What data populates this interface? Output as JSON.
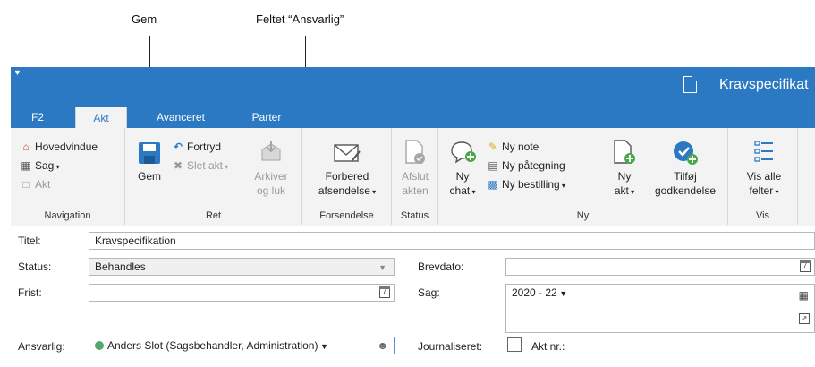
{
  "callouts": {
    "gem": "Gem",
    "ansvarlig": "Feltet “Ansvarlig”"
  },
  "window": {
    "title": "Kravspecifikat"
  },
  "tabs": [
    {
      "label": "F2",
      "active": false
    },
    {
      "label": "Akt",
      "active": true
    },
    {
      "label": "Avanceret",
      "active": false
    },
    {
      "label": "Parter",
      "active": false
    }
  ],
  "ribbon": {
    "navigation": {
      "label": "Navigation",
      "hovedvindue": "Hovedvindue",
      "sag": "Sag",
      "akt": "Akt"
    },
    "ret": {
      "label": "Ret",
      "gem": "Gem",
      "fortryd": "Fortryd",
      "slet_akt": "Slet akt",
      "arkiver_l1": "Arkiver",
      "arkiver_l2": "og luk"
    },
    "forsendelse": {
      "label": "Forsendelse",
      "forbered_l1": "Forbered",
      "forbered_l2": "afsendelse"
    },
    "status": {
      "label": "Status",
      "afslut_l1": "Afslut",
      "afslut_l2": "akten"
    },
    "ny": {
      "label": "Ny",
      "ny_chat_l1": "Ny",
      "ny_chat_l2": "chat",
      "ny_note": "Ny note",
      "ny_paategning": "Ny påtegning",
      "ny_bestilling": "Ny bestilling",
      "ny_akt_l1": "Ny",
      "ny_akt_l2": "akt",
      "tilfoej_l1": "Tilføj",
      "tilfoej_l2": "godkendelse"
    },
    "vis": {
      "label": "Vis",
      "vis_alle_l1": "Vis alle",
      "vis_alle_l2": "felter"
    }
  },
  "form": {
    "titel_label": "Titel:",
    "titel_value": "Kravspecifikation",
    "status_label": "Status:",
    "status_value": "Behandles",
    "frist_label": "Frist:",
    "frist_value": "",
    "ansvarlig_label": "Ansvarlig:",
    "ansvarlig_value": "Anders Slot (Sagsbehandler, Administration)",
    "brevdato_label": "Brevdato:",
    "brevdato_value": "",
    "sag_label": "Sag:",
    "sag_value": "2020 - 22",
    "journaliseret_label": "Journaliseret:",
    "akt_nr_label": "Akt nr.:"
  },
  "colors": {
    "accent": "#2b79c2",
    "ribbon_bg": "#f3f3f3",
    "status_green": "#56a86a"
  }
}
